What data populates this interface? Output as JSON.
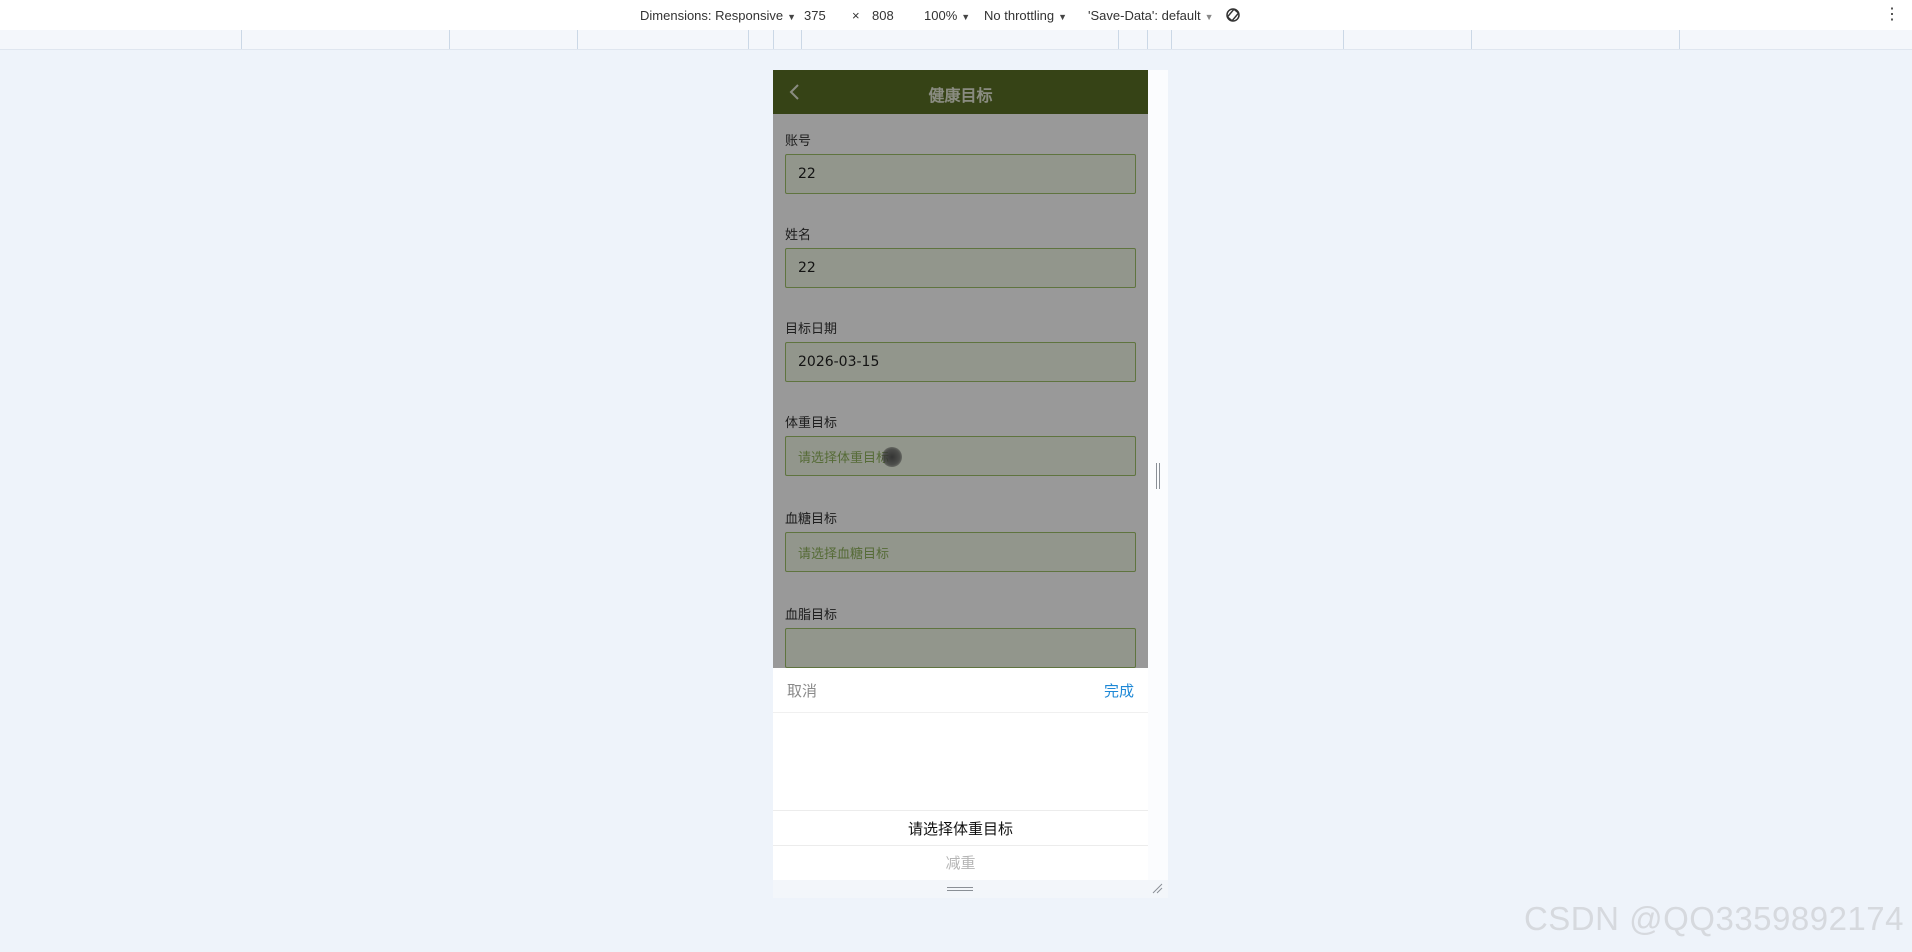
{
  "devtools": {
    "dimensions_label": "Dimensions: Responsive",
    "width_value": "375",
    "times_sign": "×",
    "height_value": "808",
    "zoom": "100%",
    "throttling": "No throttling",
    "save_data": "'Save-Data': default"
  },
  "app": {
    "header": {
      "title": "健康目标",
      "bg_color": "#5b7126"
    },
    "form": {
      "fields": [
        {
          "label": "账号",
          "value": "22"
        },
        {
          "label": "姓名",
          "value": "22"
        },
        {
          "label": "目标日期",
          "value": "2026-03-15"
        },
        {
          "label": "体重目标",
          "placeholder": "请选择体重目标"
        },
        {
          "label": "血糖目标",
          "placeholder": "请选择血糖目标"
        },
        {
          "label": "血脂目标"
        }
      ]
    },
    "picker": {
      "cancel_label": "取消",
      "confirm_label": "完成",
      "confirm_color": "#1e88d6",
      "options": [
        "请选择体重目标",
        "减重"
      ],
      "selected_index": 0
    }
  },
  "watermark": "CSDN @QQ3359892174"
}
